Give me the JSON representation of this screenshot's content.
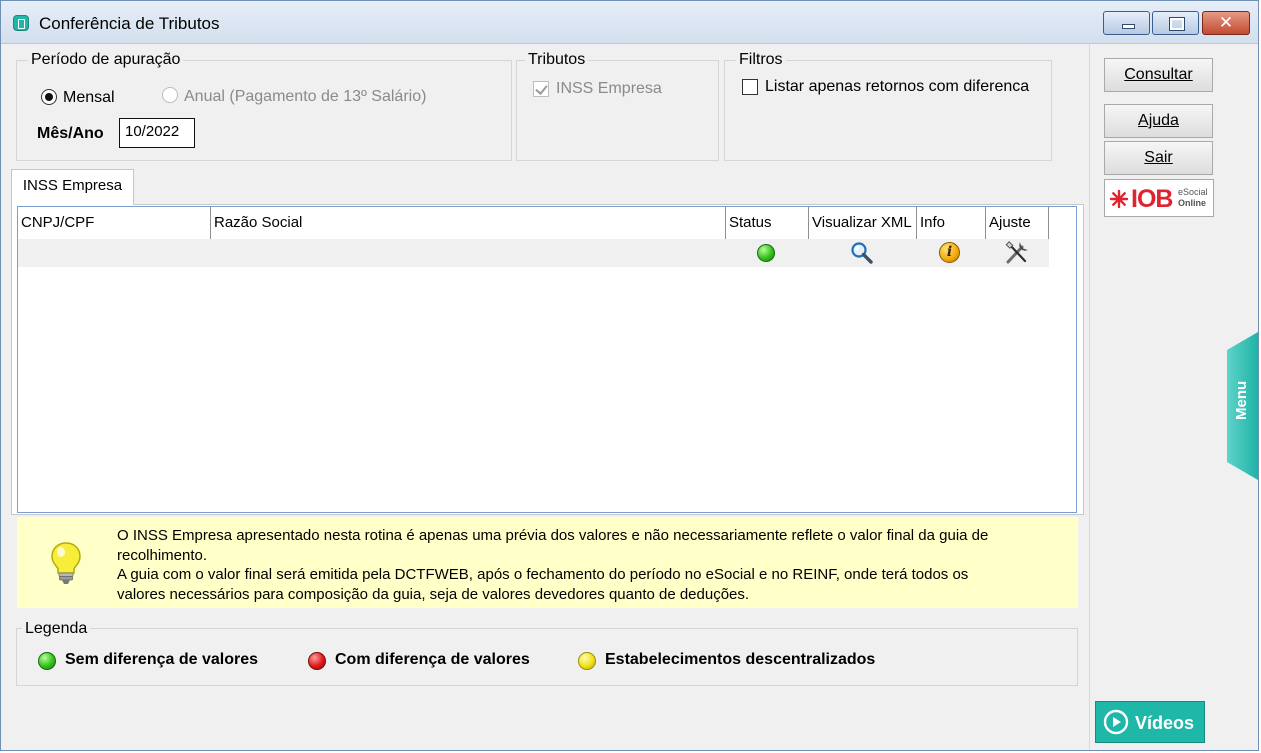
{
  "window": {
    "title": "Conferência de Tributos",
    "close_glyph": "✕"
  },
  "periodo": {
    "legend": "Período de apuração",
    "mensal_label": "Mensal",
    "anual_label": "Anual (Pagamento de 13º Salário)",
    "mesano_label": "Mês/Ano",
    "mesano_value": "10/2022",
    "selected": "Mensal"
  },
  "tributos": {
    "legend": "Tributos",
    "inss_label": "INSS Empresa",
    "inss_checked": true
  },
  "filtros": {
    "legend": "Filtros",
    "listar_label": "Listar apenas retornos com diferenca",
    "listar_checked": false
  },
  "actions": {
    "consultar": "Consultar",
    "ajuda": "Ajuda",
    "sair": "Sair"
  },
  "iob_logo": {
    "brand": "IOB",
    "line1": "eSocial",
    "line2": "Online"
  },
  "tab": {
    "label": "INSS Empresa"
  },
  "grid": {
    "columns": [
      "CNPJ/CPF",
      "Razão Social",
      "Status",
      "Visualizar XML",
      "Info",
      "Ajuste"
    ],
    "rows": [
      {
        "cnpj": "",
        "razao_social": "",
        "status": "green",
        "info_glyph": "i"
      }
    ]
  },
  "tip": {
    "lines": [
      "O INSS Empresa apresentado nesta rotina é apenas uma prévia dos valores e não necessariamente reflete o valor final da guia de",
      "recolhimento.",
      "A guia com o valor final será emitida pela DCTFWEB, após o fechamento do período no eSocial e no REINF, onde terá todos os",
      "valores necessários para composição da guia, seja de valores devedores quanto de deduções."
    ]
  },
  "legenda": {
    "legend": "Legenda",
    "items": [
      {
        "color": "green",
        "label": "Sem diferença de valores"
      },
      {
        "color": "red",
        "label": "Com diferença de valores"
      },
      {
        "color": "yellow",
        "label": "Estabelecimentos descentralizados"
      }
    ]
  },
  "menu_tab": {
    "label": "Menu"
  },
  "videos_button": {
    "label": "Vídeos"
  },
  "colors": {
    "teal_accent": "#1fb7a8",
    "tip_background": "#ffffc8",
    "iob_red": "#e0232f"
  }
}
